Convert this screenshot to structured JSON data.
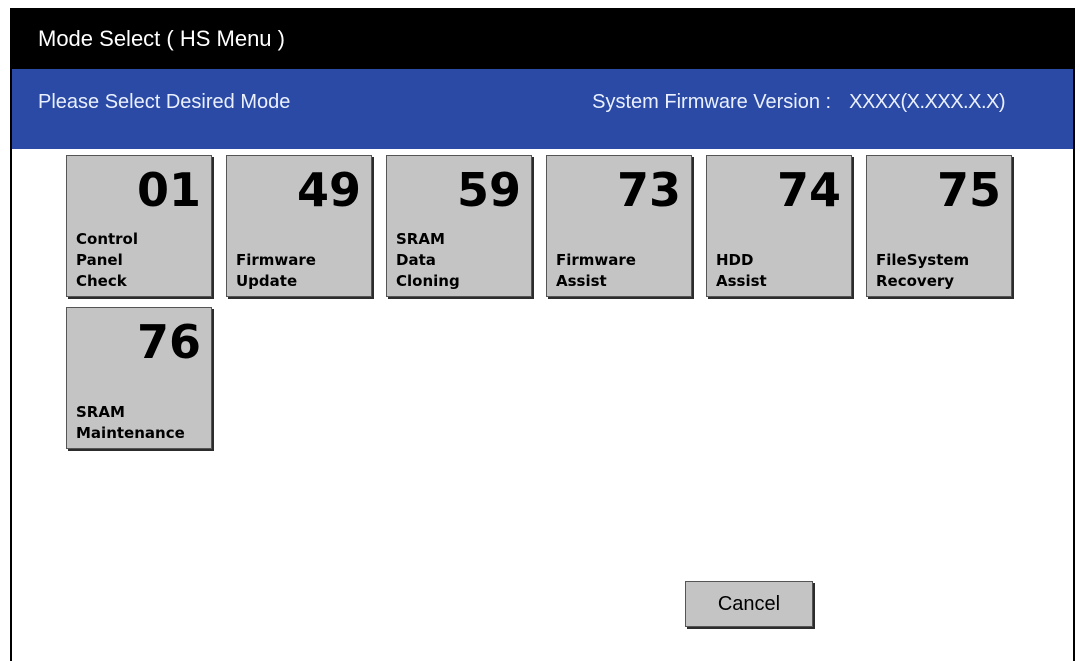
{
  "window": {
    "title": "Mode Select ( HS Menu )"
  },
  "header": {
    "prompt": "Please Select Desired Mode",
    "firmware_label": "System Firmware Version :",
    "firmware_value": "XXXX(X.XXX.X.X)"
  },
  "modes": [
    {
      "number": "01",
      "label": "Control\nPanel\nCheck"
    },
    {
      "number": "49",
      "label": "Firmware\nUpdate"
    },
    {
      "number": "59",
      "label": "SRAM\nData\nCloning"
    },
    {
      "number": "73",
      "label": "Firmware\nAssist"
    },
    {
      "number": "74",
      "label": "HDD\nAssist"
    },
    {
      "number": "75",
      "label": "FileSystem\nRecovery"
    },
    {
      "number": "76",
      "label": "SRAM\nMaintenance"
    }
  ],
  "actions": {
    "cancel_label": "Cancel"
  },
  "colors": {
    "title_bar": "#000000",
    "header_bar": "#2a4aa6",
    "button_face": "#c4c4c4"
  }
}
